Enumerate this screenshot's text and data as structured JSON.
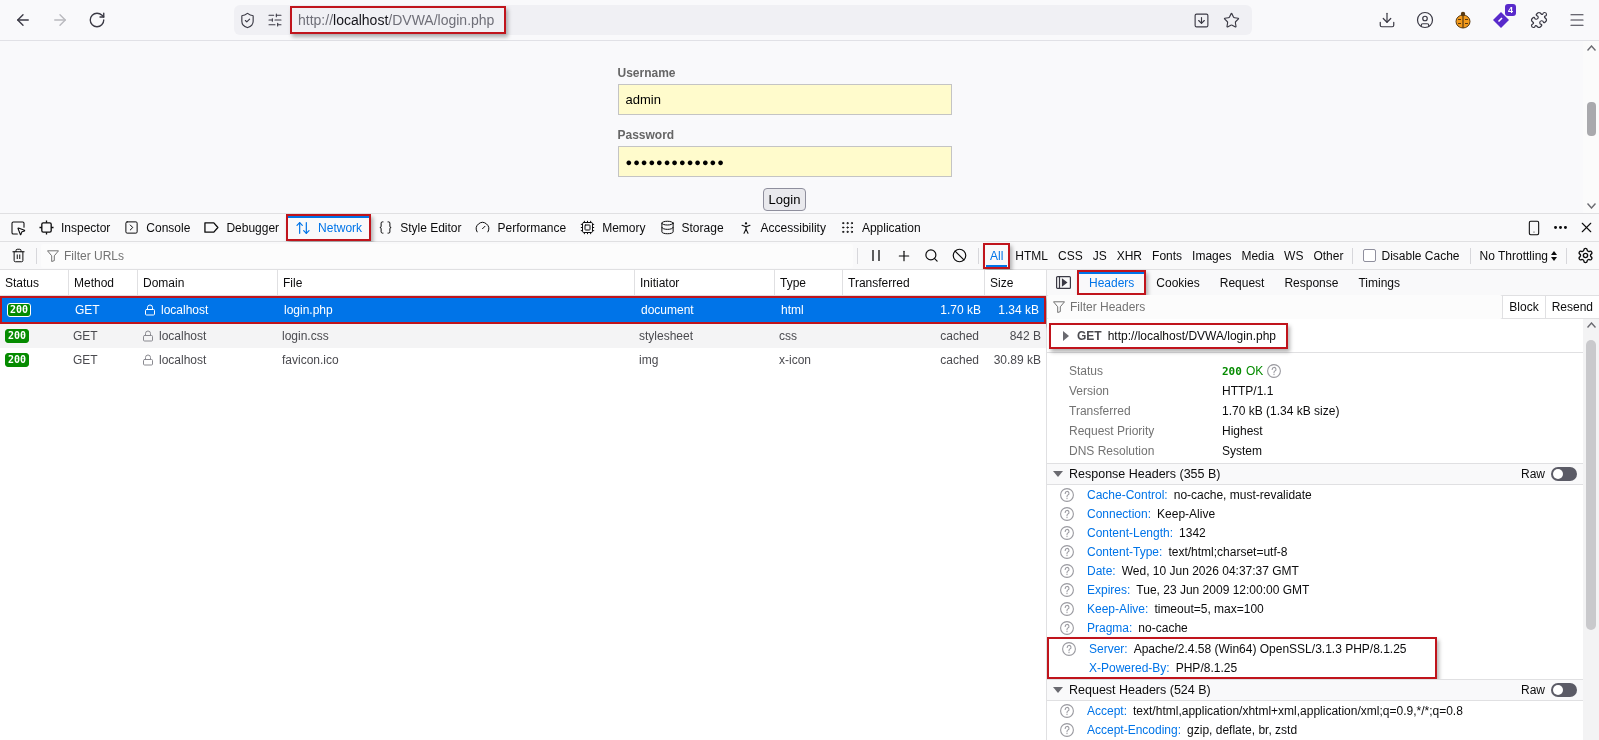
{
  "browser_toolbar": {
    "nav_buttons": [
      {
        "kind": "back",
        "disabled": false
      },
      {
        "kind": "forward",
        "disabled": true
      },
      {
        "kind": "reload",
        "disabled": false
      }
    ],
    "url": {
      "scheme": "http://",
      "host": "localhost",
      "path": "/DVWA/login.php",
      "highlighted": true
    },
    "extension_badge": "4"
  },
  "page": {
    "fields": [
      {
        "kind": "text",
        "label": "Username",
        "value": "admin"
      },
      {
        "kind": "password",
        "label": "Password",
        "value": "●●●●●●●●●●●●●"
      }
    ],
    "submit_button": "Login"
  },
  "devtools": {
    "tabs": [
      {
        "kind": "inspector",
        "label": "Inspector",
        "selected": false,
        "highlighted": false
      },
      {
        "kind": "console",
        "label": "Console",
        "selected": false,
        "highlighted": false
      },
      {
        "kind": "debugger",
        "label": "Debugger",
        "selected": false,
        "highlighted": false
      },
      {
        "kind": "network",
        "label": "Network",
        "selected": true,
        "highlighted": true
      },
      {
        "kind": "style",
        "label": "Style Editor",
        "selected": false,
        "highlighted": false
      },
      {
        "kind": "performance",
        "label": "Performance",
        "selected": false,
        "highlighted": false
      },
      {
        "kind": "memory",
        "label": "Memory",
        "selected": false,
        "highlighted": false
      },
      {
        "kind": "storage",
        "label": "Storage",
        "selected": false,
        "highlighted": false
      },
      {
        "kind": "accessibility",
        "label": "Accessibility",
        "selected": false,
        "highlighted": false
      },
      {
        "kind": "application",
        "label": "Application",
        "selected": false,
        "highlighted": false
      }
    ]
  },
  "filter_bar": {
    "placeholder": "Filter URLs",
    "types": [
      {
        "label": "All",
        "selected": true,
        "highlighted": true
      },
      {
        "label": "HTML",
        "selected": false,
        "highlighted": false
      },
      {
        "label": "CSS",
        "selected": false,
        "highlighted": false
      },
      {
        "label": "JS",
        "selected": false,
        "highlighted": false
      },
      {
        "label": "XHR",
        "selected": false,
        "highlighted": false
      },
      {
        "label": "Fonts",
        "selected": false,
        "highlighted": false
      },
      {
        "label": "Images",
        "selected": false,
        "highlighted": false
      },
      {
        "label": "Media",
        "selected": false,
        "highlighted": false
      },
      {
        "label": "WS",
        "selected": false,
        "highlighted": false
      },
      {
        "label": "Other",
        "selected": false,
        "highlighted": false
      }
    ],
    "disable_cache": {
      "label": "Disable Cache",
      "checked": false
    },
    "throttling": "No Throttling"
  },
  "requests": {
    "columns": [
      "Status",
      "Method",
      "Domain",
      "File",
      "Initiator",
      "Type",
      "Transferred",
      "Size"
    ],
    "rows": [
      {
        "status": "200",
        "method": "GET",
        "domain": "localhost",
        "file": "login.php",
        "initiator": "document",
        "type": "html",
        "transferred": "1.70 kB",
        "size": "1.34 kB",
        "selected": true,
        "highlighted": true
      },
      {
        "status": "200",
        "method": "GET",
        "domain": "localhost",
        "file": "login.css",
        "initiator": "stylesheet",
        "type": "css",
        "transferred": "cached",
        "size": "842 B",
        "selected": false,
        "highlighted": false
      },
      {
        "status": "200",
        "method": "GET",
        "domain": "localhost",
        "file": "favicon.ico",
        "initiator": "img",
        "type": "x-icon",
        "transferred": "cached",
        "size": "30.89 kB",
        "selected": false,
        "highlighted": false
      }
    ]
  },
  "details": {
    "tabs": [
      {
        "label": "Headers",
        "selected": true,
        "highlighted": true
      },
      {
        "label": "Cookies",
        "selected": false,
        "highlighted": false
      },
      {
        "label": "Request",
        "selected": false,
        "highlighted": false
      },
      {
        "label": "Response",
        "selected": false,
        "highlighted": false
      },
      {
        "label": "Timings",
        "selected": false,
        "highlighted": false
      }
    ],
    "filter_placeholder": "Filter Headers",
    "actions": [
      "Block",
      "Resend"
    ],
    "summary": {
      "method": "GET",
      "url": "http://localhost/DVWA/login.php",
      "expanded": false,
      "highlighted": true
    },
    "overview": [
      {
        "kind": "status",
        "label": "Status",
        "code": "200",
        "value": "OK"
      },
      {
        "kind": "text",
        "label": "Version",
        "value": "HTTP/1.1"
      },
      {
        "kind": "text",
        "label": "Transferred",
        "value": "1.70 kB (1.34 kB size)"
      },
      {
        "kind": "text",
        "label": "Request Priority",
        "value": "Highest"
      },
      {
        "kind": "text",
        "label": "DNS Resolution",
        "value": "System"
      }
    ],
    "sections": [
      {
        "title": "Response Headers (355 B)",
        "expanded": true,
        "raw_label": "Raw",
        "raw": false,
        "headers": [
          {
            "name": "Cache-Control:",
            "value": "no-cache, must-revalidate",
            "help": true,
            "highlighted": false
          },
          {
            "name": "Connection:",
            "value": "Keep-Alive",
            "help": true,
            "highlighted": false
          },
          {
            "name": "Content-Length:",
            "value": "1342",
            "help": true,
            "highlighted": false
          },
          {
            "name": "Content-Type:",
            "value": "text/html;charset=utf-8",
            "help": true,
            "highlighted": false
          },
          {
            "name": "Date:",
            "value": "Wed, 10 Jun 2026 04:37:37 GMT",
            "help": true,
            "highlighted": false
          },
          {
            "name": "Expires:",
            "value": "Tue, 23 Jun 2009 12:00:00 GMT",
            "help": true,
            "highlighted": false
          },
          {
            "name": "Keep-Alive:",
            "value": "timeout=5, max=100",
            "help": true,
            "highlighted": false
          },
          {
            "name": "Pragma:",
            "value": "no-cache",
            "help": true,
            "highlighted": false
          },
          {
            "name": "Server:",
            "value": "Apache/2.4.58 (Win64) OpenSSL/3.1.3 PHP/8.1.25",
            "help": true,
            "highlighted": true
          },
          {
            "name": "X-Powered-By:",
            "value": "PHP/8.1.25",
            "help": false,
            "highlighted": true
          }
        ]
      },
      {
        "title": "Request Headers (524 B)",
        "expanded": true,
        "raw_label": "Raw",
        "raw": false,
        "headers": [
          {
            "name": "Accept:",
            "value": "text/html,application/xhtml+xml,application/xml;q=0.9,*/*;q=0.8",
            "help": true,
            "highlighted": false
          },
          {
            "name": "Accept-Encoding:",
            "value": "gzip, deflate, br, zstd",
            "help": true,
            "highlighted": false
          }
        ]
      }
    ]
  }
}
